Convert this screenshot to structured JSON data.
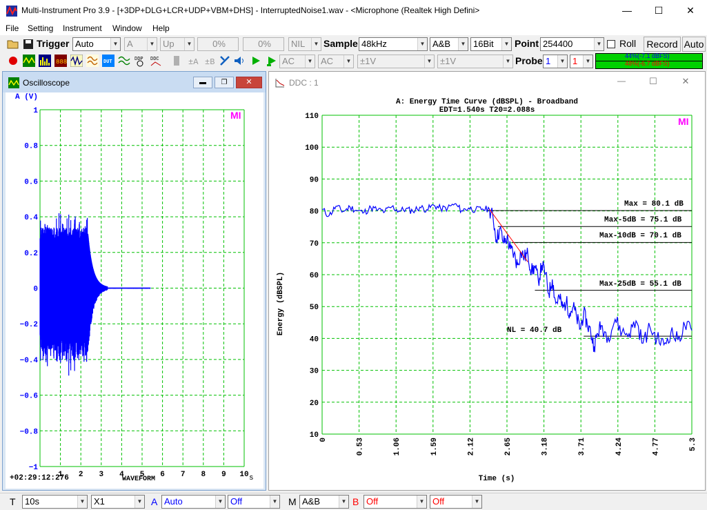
{
  "window": {
    "title": "Multi-Instrument Pro 3.9   -   [+3DP+DLG+LCR+UDP+VBM+DHS]   -   InterruptedNoise1.wav   -   <Microphone (Realtek High Defini>",
    "minimize": "—",
    "maximize": "☐",
    "close": "✕"
  },
  "menu": [
    "File",
    "Setting",
    "Instrument",
    "Window",
    "Help"
  ],
  "toolbar1": {
    "trigger_label": "Trigger",
    "trigger_mode": "Auto",
    "trigger_channel": "A",
    "trigger_edge": "Up",
    "level1": "0%",
    "level2": "0%",
    "nil": "NIL",
    "sample_label": "Sample",
    "sample_value": "48kHz",
    "channels": "A&B",
    "bits": "16Bit",
    "point_label": "Point",
    "point_value": "254400",
    "roll_label": "Roll",
    "record_label": "Record",
    "auto_label": "Auto",
    "meter_a": "44%(-7.1 dBFS)",
    "meter_b": "48%(-6.7 dBFS)"
  },
  "toolbar2": {
    "coupling_a": "AC",
    "coupling_b": "AC",
    "range_a": "±1V",
    "range_b": "±1V",
    "probe_label": "Probe",
    "probe_a": "1",
    "probe_b": "1",
    "icons": [
      "record-icon",
      "oscilloscope-icon",
      "spectrum-icon",
      "meter-icon",
      "generator-icon",
      "dut-icon",
      "dsp-icon",
      "ddp-icon",
      "ddc-icon"
    ]
  },
  "oscilloscope": {
    "title": "Oscilloscope",
    "y_unit": "A (V)",
    "y_ticks": [
      "1",
      "0.8",
      "0.6",
      "0.4",
      "0.2",
      "0",
      "−0.2",
      "−0.4",
      "−0.6",
      "−0.8",
      "−1"
    ],
    "x_ticks": [
      "1",
      "2",
      "3",
      "4",
      "5",
      "6",
      "7",
      "8",
      "9",
      "10"
    ],
    "x_unit": "s",
    "timestamp": "+02:29:12:276",
    "mode_label": "WAVEFORM",
    "logo": "MI"
  },
  "ddc": {
    "title": "DDC : 1",
    "logo": "MI",
    "chart_title": "A: Energy Time Curve (dBSPL) - Broadband",
    "chart_subtitle": "EDT=1.540s   T20=2.088s",
    "ylabel": "Energy (dBSPL)",
    "xlabel": "Time (s)",
    "annotations": {
      "max": "Max =  80.1 dB",
      "max5": "Max-5dB =  75.1 dB",
      "max10": "Max-10dB =  70.1 dB",
      "max25": "Max-25dB =  55.1 dB",
      "nl": "NL =  40.7 dB"
    }
  },
  "chart_data": {
    "type": "line",
    "title": "A: Energy Time Curve (dBSPL) - Broadband",
    "subtitle": "EDT=1.540s   T20=2.088s",
    "xlabel": "Time (s)",
    "ylabel": "Energy (dBSPL)",
    "xlim": [
      0,
      5.3
    ],
    "ylim": [
      10,
      110
    ],
    "x_ticks": [
      "0",
      "0.53",
      "1.06",
      "1.59",
      "2.12",
      "2.65",
      "3.18",
      "3.71",
      "4.24",
      "4.77",
      "5.3"
    ],
    "y_ticks": [
      "10",
      "20",
      "30",
      "40",
      "50",
      "60",
      "70",
      "80",
      "90",
      "100",
      "110"
    ],
    "grid": true,
    "series": [
      {
        "x": [
          0,
          0.1,
          0.2,
          0.3,
          0.4,
          0.5,
          0.6,
          0.7,
          0.8,
          0.9,
          1.0,
          1.1,
          1.2,
          1.3,
          1.4,
          1.5,
          1.6,
          1.7,
          1.8,
          1.9,
          2.0,
          2.1,
          2.2,
          2.3,
          2.4,
          2.45,
          2.5,
          2.55,
          2.6,
          2.65,
          2.7,
          2.75,
          2.8,
          2.85,
          2.9,
          2.95,
          3.0,
          3.05,
          3.1,
          3.15,
          3.2,
          3.25,
          3.3,
          3.35,
          3.4,
          3.45,
          3.5,
          3.55,
          3.6,
          3.65,
          3.7,
          3.75,
          3.8,
          3.85,
          3.9,
          3.95,
          4.0,
          4.1,
          4.2,
          4.3,
          4.4,
          4.5,
          4.6,
          4.7,
          4.8,
          4.9,
          5.0,
          5.1,
          5.2,
          5.3
        ],
        "values": [
          80.5,
          78.5,
          81.5,
          79.8,
          81.2,
          80.1,
          79.5,
          81.0,
          80.3,
          79.8,
          81.3,
          80.0,
          80.6,
          79.9,
          81.2,
          80.4,
          81.8,
          80.7,
          80.9,
          82.2,
          80.1,
          80.9,
          80.3,
          80.6,
          80.5,
          78.0,
          71.0,
          74.5,
          70.0,
          71.5,
          68.0,
          66.5,
          63.0,
          67.0,
          65.5,
          66.5,
          61.0,
          62.5,
          58.0,
          63.0,
          60.5,
          54.0,
          58.5,
          51.0,
          53.0,
          49.5,
          51.5,
          48.0,
          50.0,
          46.5,
          43.0,
          48.0,
          44.5,
          42.0,
          37.5,
          41.5,
          44.0,
          40.5,
          46.0,
          42.0,
          41.5,
          45.5,
          38.5,
          43.5,
          40.0,
          38.0,
          42.0,
          39.5,
          44.0,
          42.5
        ]
      }
    ],
    "reference_lines": [
      {
        "label": "Max",
        "value": 80.1
      },
      {
        "label": "Max-5dB",
        "value": 75.1
      },
      {
        "label": "Max-10dB",
        "value": 70.1
      },
      {
        "label": "Max-25dB",
        "value": 55.1
      },
      {
        "label": "NL",
        "value": 40.7
      }
    ]
  },
  "bottombar": {
    "t_label": "T",
    "timebase": "10s",
    "zoom": "X1",
    "a_label": "A",
    "a_trigger": "Auto",
    "a_off": "Off",
    "m_label": "M",
    "m_value": "A&B",
    "b_label": "B",
    "b_off1": "Off",
    "b_off2": "Off"
  },
  "colors": {
    "trace": "#0000ff",
    "grid": "#00c000",
    "slope": "#ff0000",
    "logo": "#ff00ff"
  }
}
